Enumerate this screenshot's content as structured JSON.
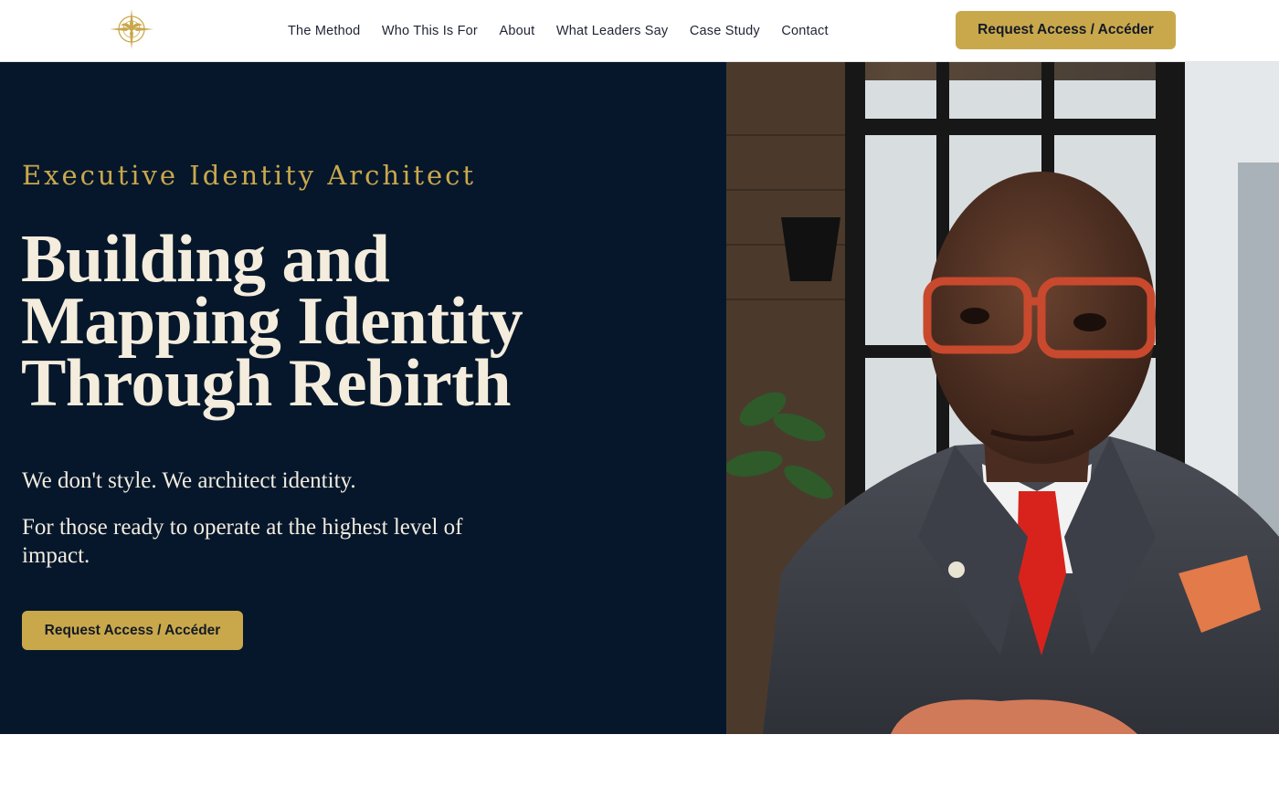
{
  "header": {
    "logo": {
      "icon": "phoenix-compass-logo",
      "color": "#c9a84c"
    },
    "nav": [
      {
        "label": "The Method"
      },
      {
        "label": "Who This Is For"
      },
      {
        "label": "About"
      },
      {
        "label": "What Leaders Say"
      },
      {
        "label": "Case Study"
      },
      {
        "label": "Contact"
      }
    ],
    "cta_label": "Request Access / Accéder"
  },
  "hero": {
    "eyebrow": "Executive Identity Architect",
    "headline_lines": [
      "Building and",
      "Mapping Identity",
      "Through Rebirth"
    ],
    "subtitle_1": "We don't style. We architect identity.",
    "subtitle_2": "For those ready to operate at the highest level of impact.",
    "cta_label": "Request Access / Accéder",
    "portrait": {
      "icon": "portrait-photo"
    }
  },
  "colors": {
    "accent_gold": "#c9a84c",
    "hero_background": "#06172b",
    "hero_text": "#f4ecdc",
    "header_background": "#ffffff",
    "nav_text": "#1d2433"
  }
}
